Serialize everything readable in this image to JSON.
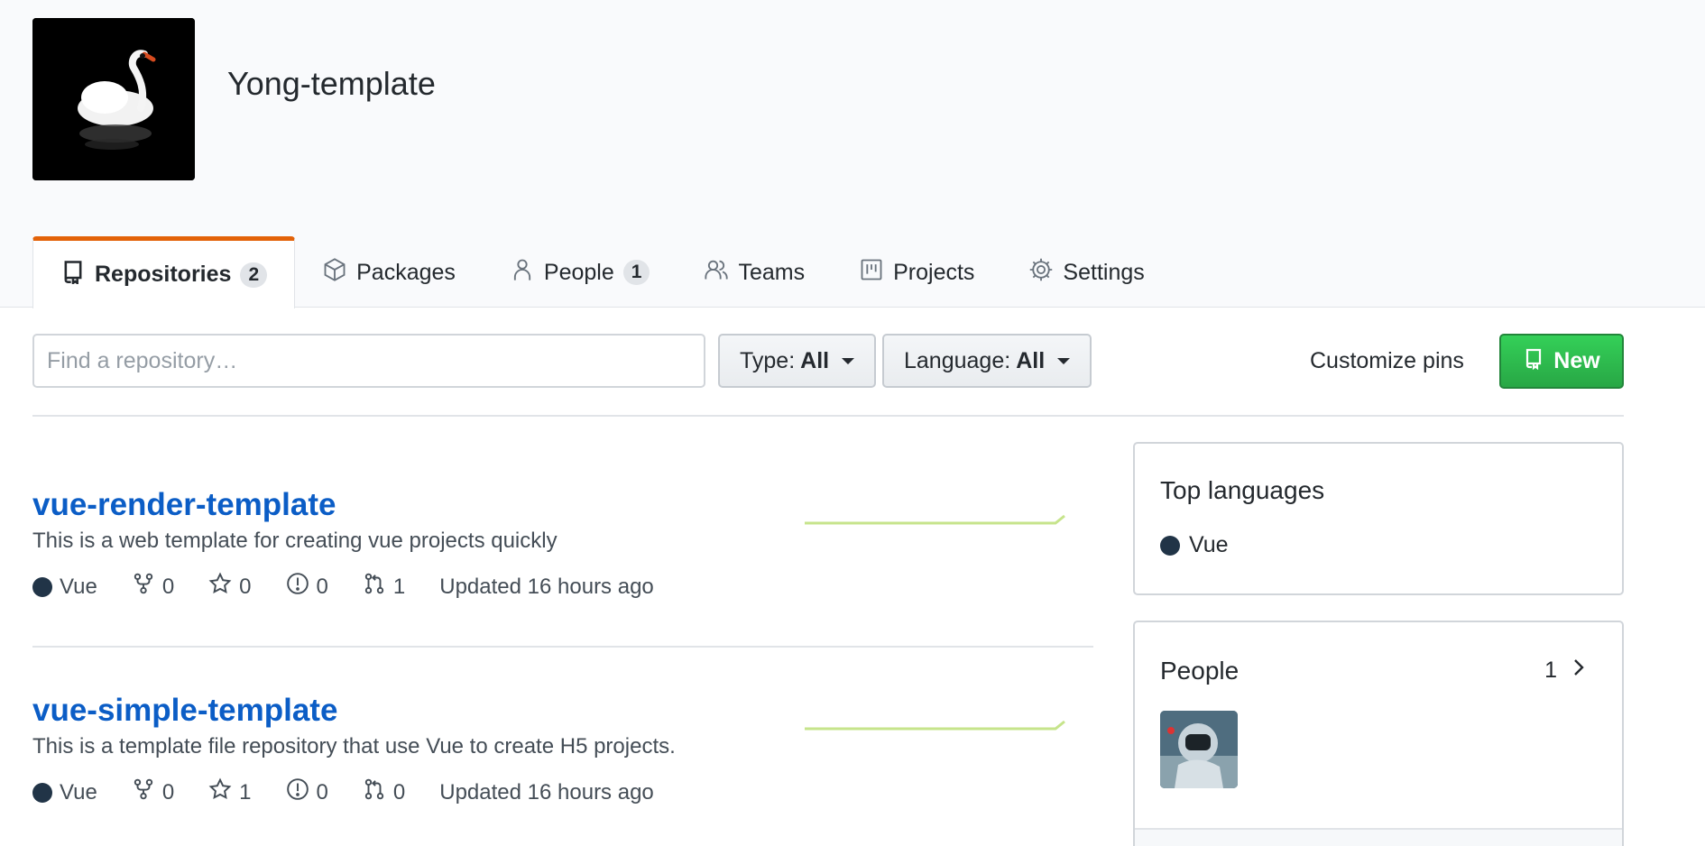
{
  "org": {
    "name": "Yong-template"
  },
  "tabs": [
    {
      "label": "Repositories",
      "count": "2",
      "icon": "repo-icon"
    },
    {
      "label": "Packages",
      "icon": "package-icon"
    },
    {
      "label": "People",
      "count": "1",
      "icon": "person-icon"
    },
    {
      "label": "Teams",
      "icon": "people-icon"
    },
    {
      "label": "Projects",
      "icon": "project-icon"
    },
    {
      "label": "Settings",
      "icon": "gear-icon"
    }
  ],
  "toolbar": {
    "search_placeholder": "Find a repository…",
    "type_label": "Type:",
    "type_value": "All",
    "language_label": "Language:",
    "language_value": "All",
    "customize_label": "Customize pins",
    "new_label": "New"
  },
  "repos": [
    {
      "name": "vue-render-template",
      "description": "This is a web template for creating vue projects quickly",
      "language": "Vue",
      "forks": "0",
      "stars": "0",
      "issues": "0",
      "pulls": "1",
      "updated": "Updated 16 hours ago"
    },
    {
      "name": "vue-simple-template",
      "description": "This is a template file repository that use Vue to create H5 projects.",
      "language": "Vue",
      "forks": "0",
      "stars": "1",
      "issues": "0",
      "pulls": "0",
      "updated": "Updated 16 hours ago"
    }
  ],
  "sidebar": {
    "top_languages_title": "Top languages",
    "top_language": "Vue",
    "people_title": "People",
    "people_count": "1"
  },
  "colors": {
    "accent_tab": "#e36209",
    "link": "#0b5dc6",
    "new_button": "#28a745",
    "vue_dot": "#213447",
    "sparkline": "#c6e48b"
  }
}
